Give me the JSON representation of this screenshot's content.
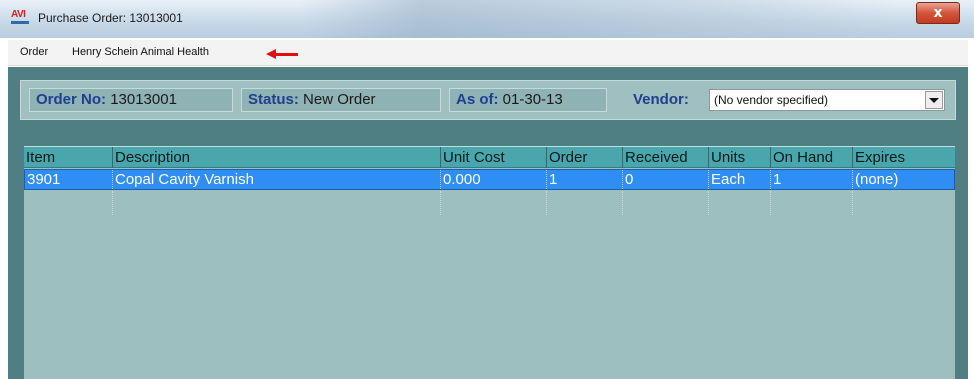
{
  "window": {
    "title": "Purchase Order: 13013001",
    "icon_text": "AVI",
    "close_symbol": "x",
    "accent_colors": {
      "panel": "#4f7f83",
      "grid_header": "#4aa6ad",
      "selected_row": "#2f8ef3",
      "field_label": "#1f3f8f",
      "annotation_arrow": "#e01010"
    }
  },
  "menubar": {
    "items": [
      "Order",
      "Henry Schein Animal Health"
    ],
    "annotation": "red-arrow-pointing-left"
  },
  "header": {
    "order_no_label": "Order No:",
    "order_no_value": "13013001",
    "status_label": "Status:",
    "status_value": "New Order",
    "as_of_label": "As of:",
    "as_of_value": "01-30-13",
    "vendor_label": "Vendor:",
    "vendor_value": "(No vendor specified)"
  },
  "grid": {
    "columns": [
      "Item",
      "Description",
      "Unit Cost",
      "Order",
      "Received",
      "Units",
      "On Hand",
      "Expires"
    ],
    "rows": [
      {
        "selected": true,
        "cells": [
          "3901",
          "Copal Cavity Varnish",
          "0.000",
          "1",
          "0",
          "Each",
          "1",
          "(none)"
        ]
      }
    ]
  }
}
